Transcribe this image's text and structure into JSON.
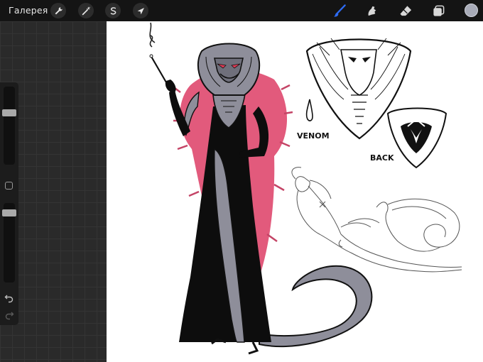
{
  "topbar": {
    "gallery_label": "Галерея",
    "left_tool_icons": [
      "wrench-icon",
      "magic-wand-icon",
      "selection-icon",
      "transform-arrow-icon"
    ],
    "right_tool_icons": [
      "brush-icon",
      "smudge-icon",
      "eraser-icon",
      "layers-icon"
    ],
    "active_tool": "brush",
    "accent_color": "#2e6cf5",
    "current_color": "#a8abb8"
  },
  "sidebar": {
    "brush_size_slider": 0.3,
    "opacity_slider": 0.05,
    "icons": [
      "modify-square-icon",
      "undo-icon",
      "redo-icon"
    ]
  },
  "canvas": {
    "background": "#ffffff",
    "annotations": {
      "venom": "VENOM",
      "back": "BACK"
    },
    "colors": {
      "boa": "#e25a7c",
      "dress": "#0d0d0d",
      "skin": "#8e8e9a",
      "eyes": "#e03a55"
    }
  }
}
